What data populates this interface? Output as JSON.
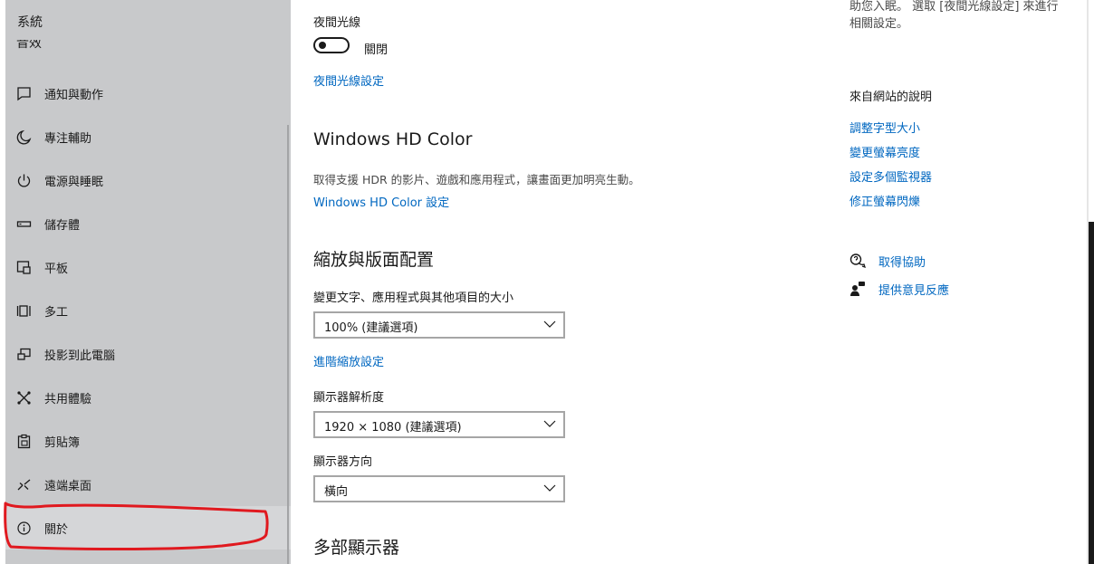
{
  "sidebar": {
    "title": "系統",
    "partial_item": "音效",
    "items": [
      {
        "label": "通知與動作",
        "icon": "notification-icon"
      },
      {
        "label": "專注輔助",
        "icon": "moon-icon"
      },
      {
        "label": "電源與睡眠",
        "icon": "power-icon"
      },
      {
        "label": "儲存體",
        "icon": "storage-icon"
      },
      {
        "label": "平板",
        "icon": "tablet-icon"
      },
      {
        "label": "多工",
        "icon": "multitasking-icon"
      },
      {
        "label": "投影到此電腦",
        "icon": "project-icon"
      },
      {
        "label": "共用體驗",
        "icon": "shared-experiences-icon"
      },
      {
        "label": "剪貼簿",
        "icon": "clipboard-icon"
      },
      {
        "label": "遠端桌面",
        "icon": "remote-desktop-icon"
      },
      {
        "label": "關於",
        "icon": "info-icon"
      }
    ],
    "annotation_color": "#e0191f"
  },
  "main": {
    "night_light": {
      "title": "夜間光線",
      "state": "關閉",
      "settings_link": "夜間光線設定"
    },
    "hdr": {
      "title": "Windows HD Color",
      "description": "取得支援 HDR 的影片、遊戲和應用程式，讓畫面更加明亮生動。",
      "settings_link": "Windows HD Color 設定"
    },
    "scale_layout": {
      "title": "縮放與版面配置",
      "scale_label": "變更文字、應用程式與其他項目的大小",
      "scale_value": "100% (建議選項)",
      "advanced_link": "進階縮放設定",
      "resolution_label": "顯示器解析度",
      "resolution_value": "1920 × 1080 (建議選項)",
      "orientation_label": "顯示器方向",
      "orientation_value": "橫向"
    },
    "multiple_displays": {
      "title": "多部顯示器"
    }
  },
  "right_panel": {
    "top_text": "助您入眠。 選取 [夜間光線設定] 來進行相關設定。",
    "web_help_title": "來自網站的說明",
    "web_links": [
      "調整字型大小",
      "變更螢幕亮度",
      "設定多個監視器",
      "修正螢幕閃爍"
    ],
    "get_help": "取得協助",
    "give_feedback": "提供意見反應"
  },
  "colors": {
    "accent": "#0067c0",
    "sidebar_bg": "#c8c9cb"
  }
}
